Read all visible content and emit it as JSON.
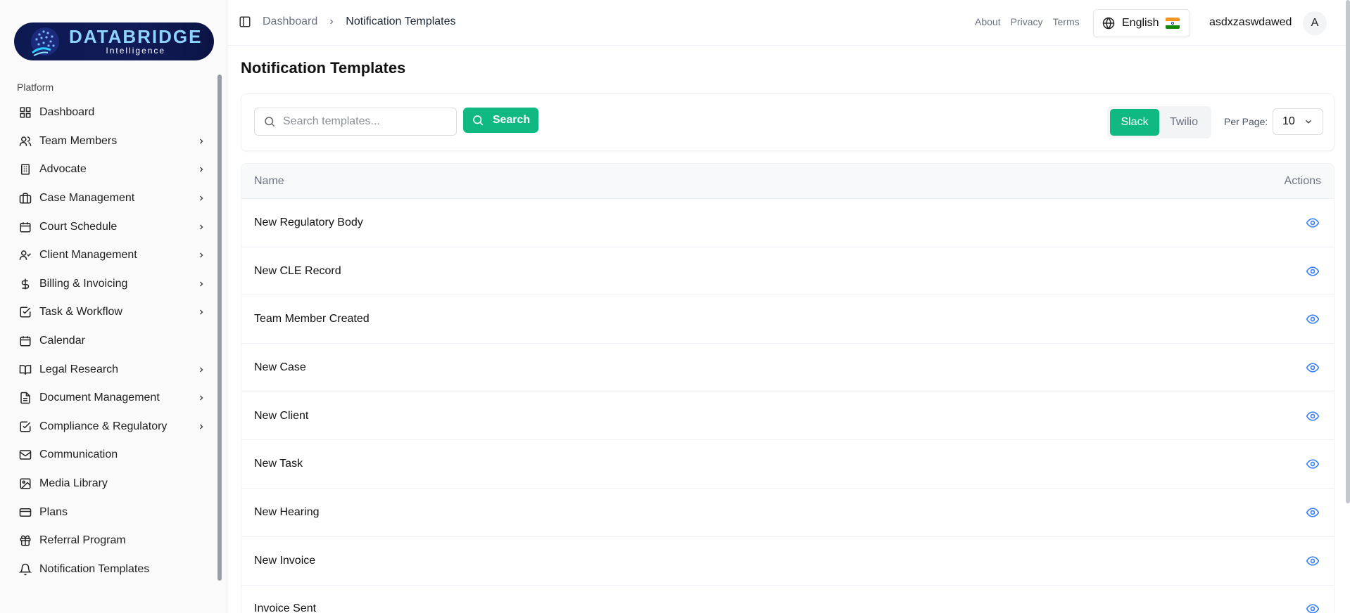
{
  "brand": {
    "title": "DATABRIDGE",
    "subtitle": "Intelligence"
  },
  "sidebar": {
    "section": "Platform",
    "items": [
      {
        "label": "Dashboard",
        "icon": "grid-icon",
        "chevron": false
      },
      {
        "label": "Team Members",
        "icon": "users-icon",
        "chevron": true
      },
      {
        "label": "Advocate",
        "icon": "building-icon",
        "chevron": true
      },
      {
        "label": "Case Management",
        "icon": "briefcase-icon",
        "chevron": true
      },
      {
        "label": "Court Schedule",
        "icon": "calendar-icon",
        "chevron": true
      },
      {
        "label": "Client Management",
        "icon": "user-check-icon",
        "chevron": true
      },
      {
        "label": "Billing & Invoicing",
        "icon": "dollar-icon",
        "chevron": true
      },
      {
        "label": "Task & Workflow",
        "icon": "checkbox-icon",
        "chevron": true
      },
      {
        "label": "Calendar",
        "icon": "calendar-days-icon",
        "chevron": false
      },
      {
        "label": "Legal Research",
        "icon": "book-open-icon",
        "chevron": true
      },
      {
        "label": "Document Management",
        "icon": "file-text-icon",
        "chevron": true
      },
      {
        "label": "Compliance & Regulatory",
        "icon": "checkbox-icon",
        "chevron": true
      },
      {
        "label": "Communication",
        "icon": "mail-icon",
        "chevron": false
      },
      {
        "label": "Media Library",
        "icon": "image-icon",
        "chevron": false
      },
      {
        "label": "Plans",
        "icon": "credit-card-icon",
        "chevron": false
      },
      {
        "label": "Referral Program",
        "icon": "gift-icon",
        "chevron": false
      },
      {
        "label": "Notification Templates",
        "icon": "bell-icon",
        "chevron": false
      }
    ]
  },
  "header": {
    "breadcrumb": {
      "parent": "Dashboard",
      "current": "Notification Templates"
    },
    "links": {
      "about": "About",
      "privacy": "Privacy",
      "terms": "Terms"
    },
    "language": "English",
    "username": "asdxzaswdawed",
    "avatar_initial": "A"
  },
  "main": {
    "title": "Notification Templates",
    "search": {
      "placeholder": "Search templates...",
      "value": "",
      "button": "Search"
    },
    "channels": {
      "slack": "Slack",
      "twilio": "Twilio",
      "active": "Slack"
    },
    "per_page": {
      "label": "Per Page:",
      "value": "10"
    },
    "table": {
      "columns": {
        "name": "Name",
        "actions": "Actions"
      },
      "rows": [
        "New Regulatory Body",
        "New CLE Record",
        "Team Member Created",
        "New Case",
        "New Client",
        "New Task",
        "New Hearing",
        "New Invoice",
        "Invoice Sent"
      ]
    }
  },
  "colors": {
    "accent": "#10b981",
    "link": "#3b82f6",
    "brand_bg": "#0d1a52"
  }
}
